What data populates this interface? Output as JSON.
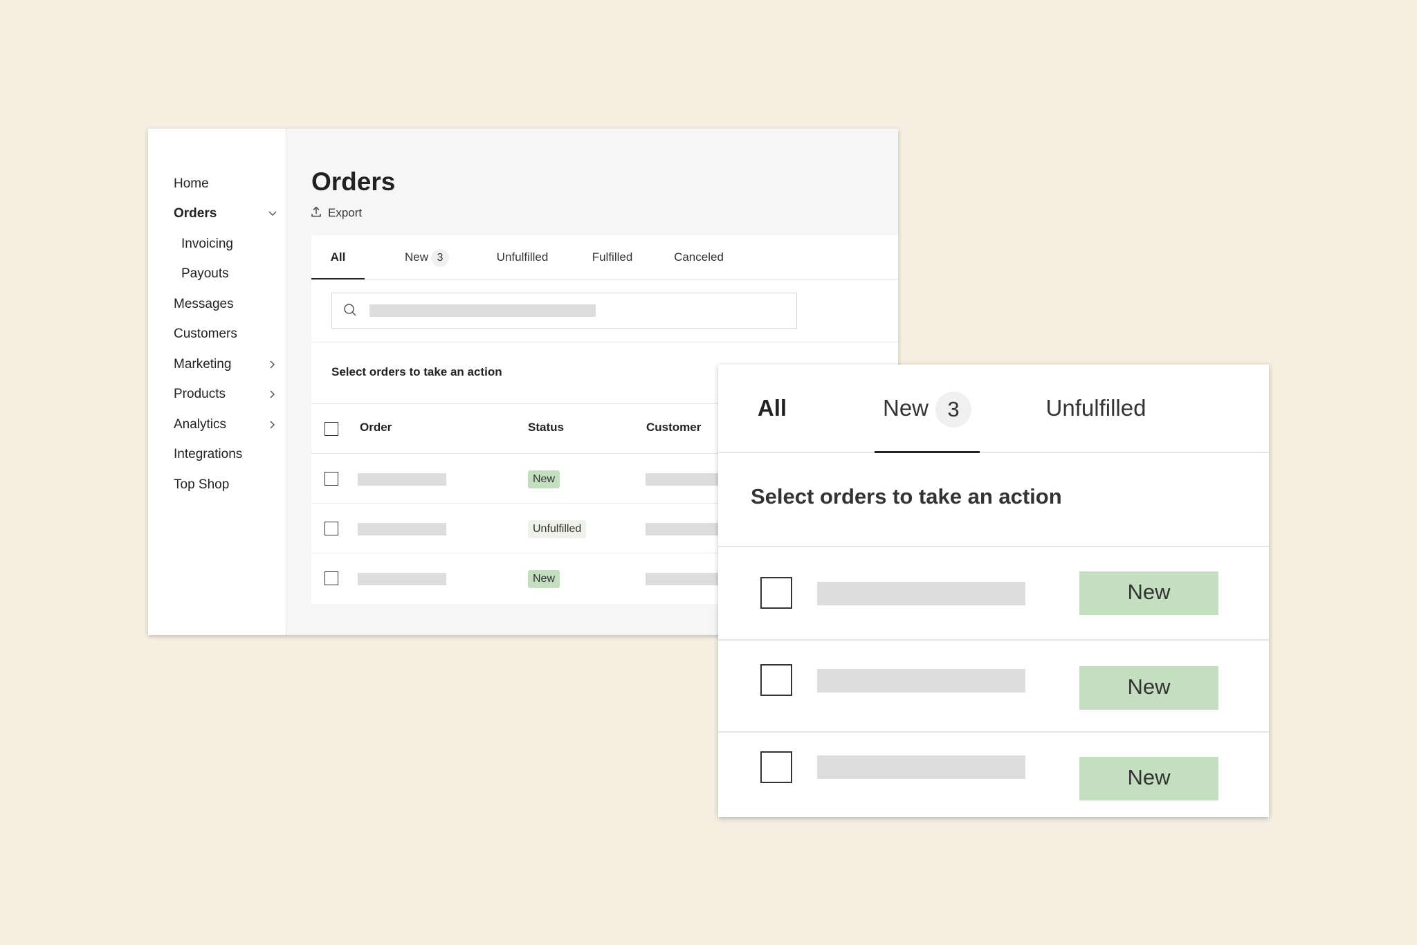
{
  "sidebar": {
    "items": [
      {
        "label": "Home"
      },
      {
        "label": "Orders"
      },
      {
        "label": "Invoicing"
      },
      {
        "label": "Payouts"
      },
      {
        "label": "Messages"
      },
      {
        "label": "Customers"
      },
      {
        "label": "Marketing"
      },
      {
        "label": "Products"
      },
      {
        "label": "Analytics"
      },
      {
        "label": "Integrations"
      },
      {
        "label": "Top Shop"
      }
    ]
  },
  "header": {
    "title": "Orders",
    "export_label": "Export"
  },
  "tabs": [
    {
      "label": "All"
    },
    {
      "label": "New",
      "count": "3"
    },
    {
      "label": "Unfulfilled"
    },
    {
      "label": "Fulfilled"
    },
    {
      "label": "Canceled"
    }
  ],
  "table": {
    "action_text": "Select orders to take an action",
    "columns": [
      "Order",
      "Status",
      "Customer"
    ],
    "rows": [
      {
        "status": "New"
      },
      {
        "status": "Unfulfilled"
      },
      {
        "status": "New"
      }
    ]
  },
  "zoom": {
    "tabs": [
      {
        "label": "All"
      },
      {
        "label": "New",
        "count": "3"
      },
      {
        "label": "Unfulfilled"
      }
    ],
    "action_text": "Select orders to take an action",
    "rows": [
      {
        "status": "New"
      },
      {
        "status": "New"
      },
      {
        "status": "New"
      }
    ]
  },
  "colors": {
    "background": "#f6eee1",
    "badge_new": "#c4dec0",
    "badge_unfulfilled": "#eef2e9",
    "skeleton": "#dddddd"
  }
}
